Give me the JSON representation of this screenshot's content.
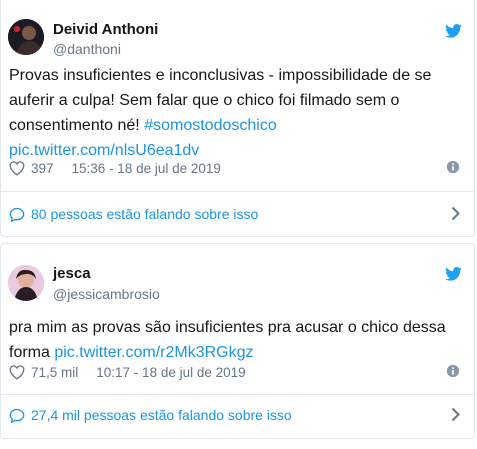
{
  "colors": {
    "link": "#1b95e0",
    "muted": "#657786",
    "text": "#14171a",
    "twitter_blue": "#1da1f2"
  },
  "tweets": [
    {
      "name": "Deivid Anthoni",
      "handle": "@danthoni",
      "text_plain": "Provas insuficientes e inconclusivas - impossibilidade de se auferir a culpa! Sem falar que o chico foi filmado sem o consentimento né! ",
      "hashtag": "#somostodoschico",
      "link": "pic.twitter.com/nlsU6ea1dv",
      "likes": "397",
      "timestamp": "15:36 - 18 de jul de 2019",
      "talking": "80 pessoas estão falando sobre isso"
    },
    {
      "name": "jesca",
      "handle": "@jessicambrosio",
      "text_plain": "pra mim as provas são insuficientes pra acusar o chico dessa forma ",
      "link": "pic.twitter.com/r2Mk3RGkgz",
      "likes": "71,5 mil",
      "timestamp": "10:17 - 18 de jul de 2019",
      "talking": "27,4 mil pessoas estão falando sobre isso"
    }
  ],
  "icons": [
    "twitter-bird-icon",
    "heart-icon",
    "info-icon",
    "comment-bubble-icon",
    "chevron-right-icon"
  ]
}
